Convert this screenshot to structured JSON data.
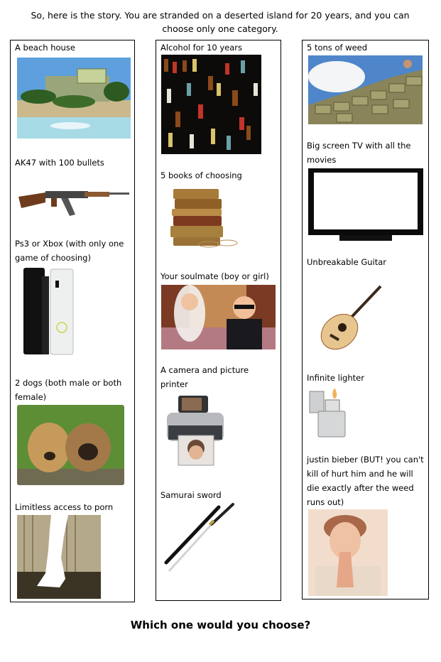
{
  "intro": "So, here is the story. You are stranded on a deserted island for 20 years, and you can choose only one category.",
  "columns": [
    {
      "items": [
        {
          "label": "A beach house",
          "image": "beach-house-image"
        },
        {
          "label": "AK47 with 100 bullets",
          "image": "ak47-rifle-image"
        },
        {
          "label": "Ps3 or Xbox (with only one game of choosing)",
          "image": "game-consoles-image"
        },
        {
          "label": "2 dogs (both male or both female)",
          "image": "puppies-image"
        },
        {
          "label": "Limitless access to porn",
          "image": "censored-silhouette-image"
        }
      ]
    },
    {
      "items": [
        {
          "label": "Alcohol for 10 years",
          "image": "liquor-bottles-image"
        },
        {
          "label": "5 books of choosing",
          "image": "book-stack-image"
        },
        {
          "label": "Your soulmate (boy or girl)",
          "image": "wedding-couple-image"
        },
        {
          "label": "A camera and picture printer",
          "image": "photo-printer-image"
        },
        {
          "label": "Samurai sword",
          "image": "katana-image"
        }
      ]
    },
    {
      "items": [
        {
          "label": "5 tons of weed",
          "image": "bale-stack-image"
        },
        {
          "label": "Big screen TV with all the movies",
          "image": "television-image"
        },
        {
          "label": "Unbreakable Guitar",
          "image": "acoustic-guitar-image"
        },
        {
          "label": "Infinite lighter",
          "image": "lighter-image"
        },
        {
          "label": "justin bieber (BUT! you can't kill of hurt him and he will die exactly after the weed runs out)",
          "image": "portrait-photo-image"
        }
      ]
    }
  ],
  "question": "Which one would you choose?"
}
